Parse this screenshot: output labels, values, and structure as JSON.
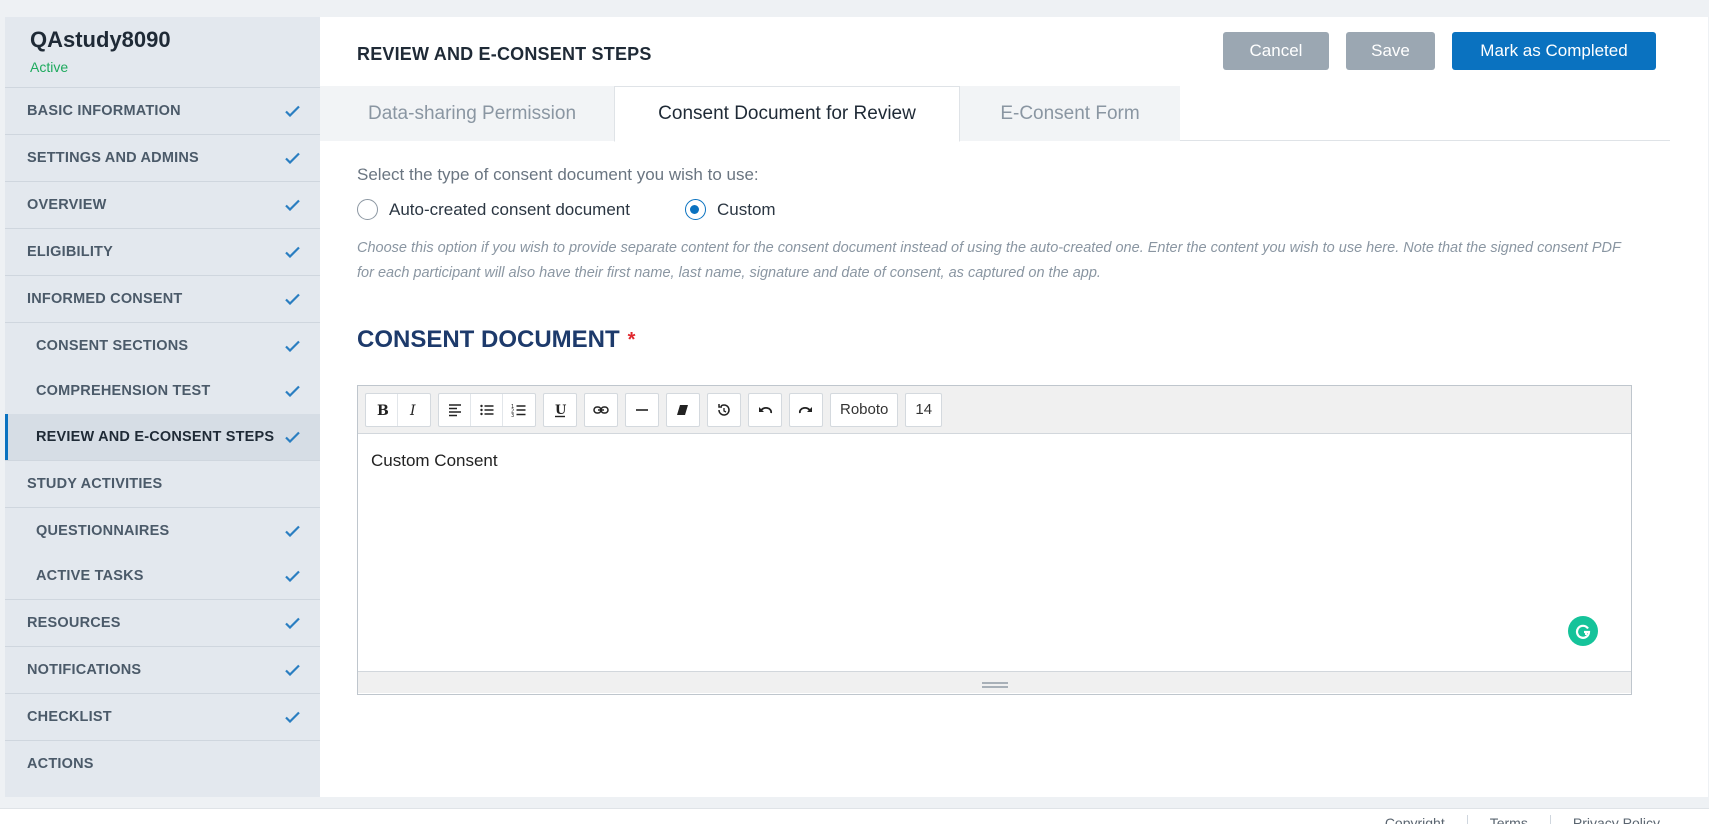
{
  "study": {
    "name": "QAstudy8090",
    "status": "Active"
  },
  "sidebar": {
    "items": [
      {
        "label": "BASIC INFORMATION",
        "checked": true,
        "sub": false,
        "active": false
      },
      {
        "label": "SETTINGS AND ADMINS",
        "checked": true,
        "sub": false,
        "active": false
      },
      {
        "label": "OVERVIEW",
        "checked": true,
        "sub": false,
        "active": false
      },
      {
        "label": "ELIGIBILITY",
        "checked": true,
        "sub": false,
        "active": false
      },
      {
        "label": "INFORMED CONSENT",
        "checked": true,
        "sub": false,
        "active": false
      },
      {
        "label": "CONSENT SECTIONS",
        "checked": true,
        "sub": true,
        "active": false
      },
      {
        "label": "COMPREHENSION TEST",
        "checked": true,
        "sub": true,
        "active": false
      },
      {
        "label": "REVIEW AND E-CONSENT STEPS",
        "checked": true,
        "sub": true,
        "active": true
      },
      {
        "label": "STUDY ACTIVITIES",
        "checked": false,
        "sub": false,
        "active": false
      },
      {
        "label": "QUESTIONNAIRES",
        "checked": true,
        "sub": true,
        "active": false
      },
      {
        "label": "ACTIVE TASKS",
        "checked": true,
        "sub": true,
        "active": false
      },
      {
        "label": "RESOURCES",
        "checked": true,
        "sub": false,
        "active": false
      },
      {
        "label": "NOTIFICATIONS",
        "checked": true,
        "sub": false,
        "active": false
      },
      {
        "label": "CHECKLIST",
        "checked": true,
        "sub": false,
        "active": false
      },
      {
        "label": "ACTIONS",
        "checked": false,
        "sub": false,
        "active": false
      }
    ]
  },
  "header": {
    "title": "REVIEW AND E-CONSENT STEPS",
    "cancel_label": "Cancel",
    "save_label": "Save",
    "complete_label": "Mark as Completed"
  },
  "tabs": [
    {
      "label": "Data-sharing Permission",
      "active": false
    },
    {
      "label": "Consent Document for Review",
      "active": true
    },
    {
      "label": "E-Consent Form",
      "active": false
    }
  ],
  "consent_type": {
    "question": "Select the type of consent document you wish to use:",
    "options": [
      {
        "label": "Auto-created consent document",
        "selected": false
      },
      {
        "label": "Custom",
        "selected": true
      }
    ],
    "help_text": "Choose this option if you wish to provide separate content for the consent document instead of using the auto-created one. Enter the content you wish to use here. Note that the signed consent PDF for each participant will also have their first name, last name, signature and date of consent, as captured on the app."
  },
  "consent_document": {
    "title": "CONSENT DOCUMENT",
    "required_mark": "*",
    "font_name": "Roboto",
    "font_size": "14",
    "content": "Custom Consent"
  },
  "footer": {
    "links": [
      "Copyright",
      "Terms",
      "Privacy Policy"
    ]
  },
  "colors": {
    "accent": "#0a72c0",
    "check": "#2a7ec1",
    "status": "#1eaa5e",
    "required": "#e0282e",
    "section_title": "#1d3a6b"
  }
}
